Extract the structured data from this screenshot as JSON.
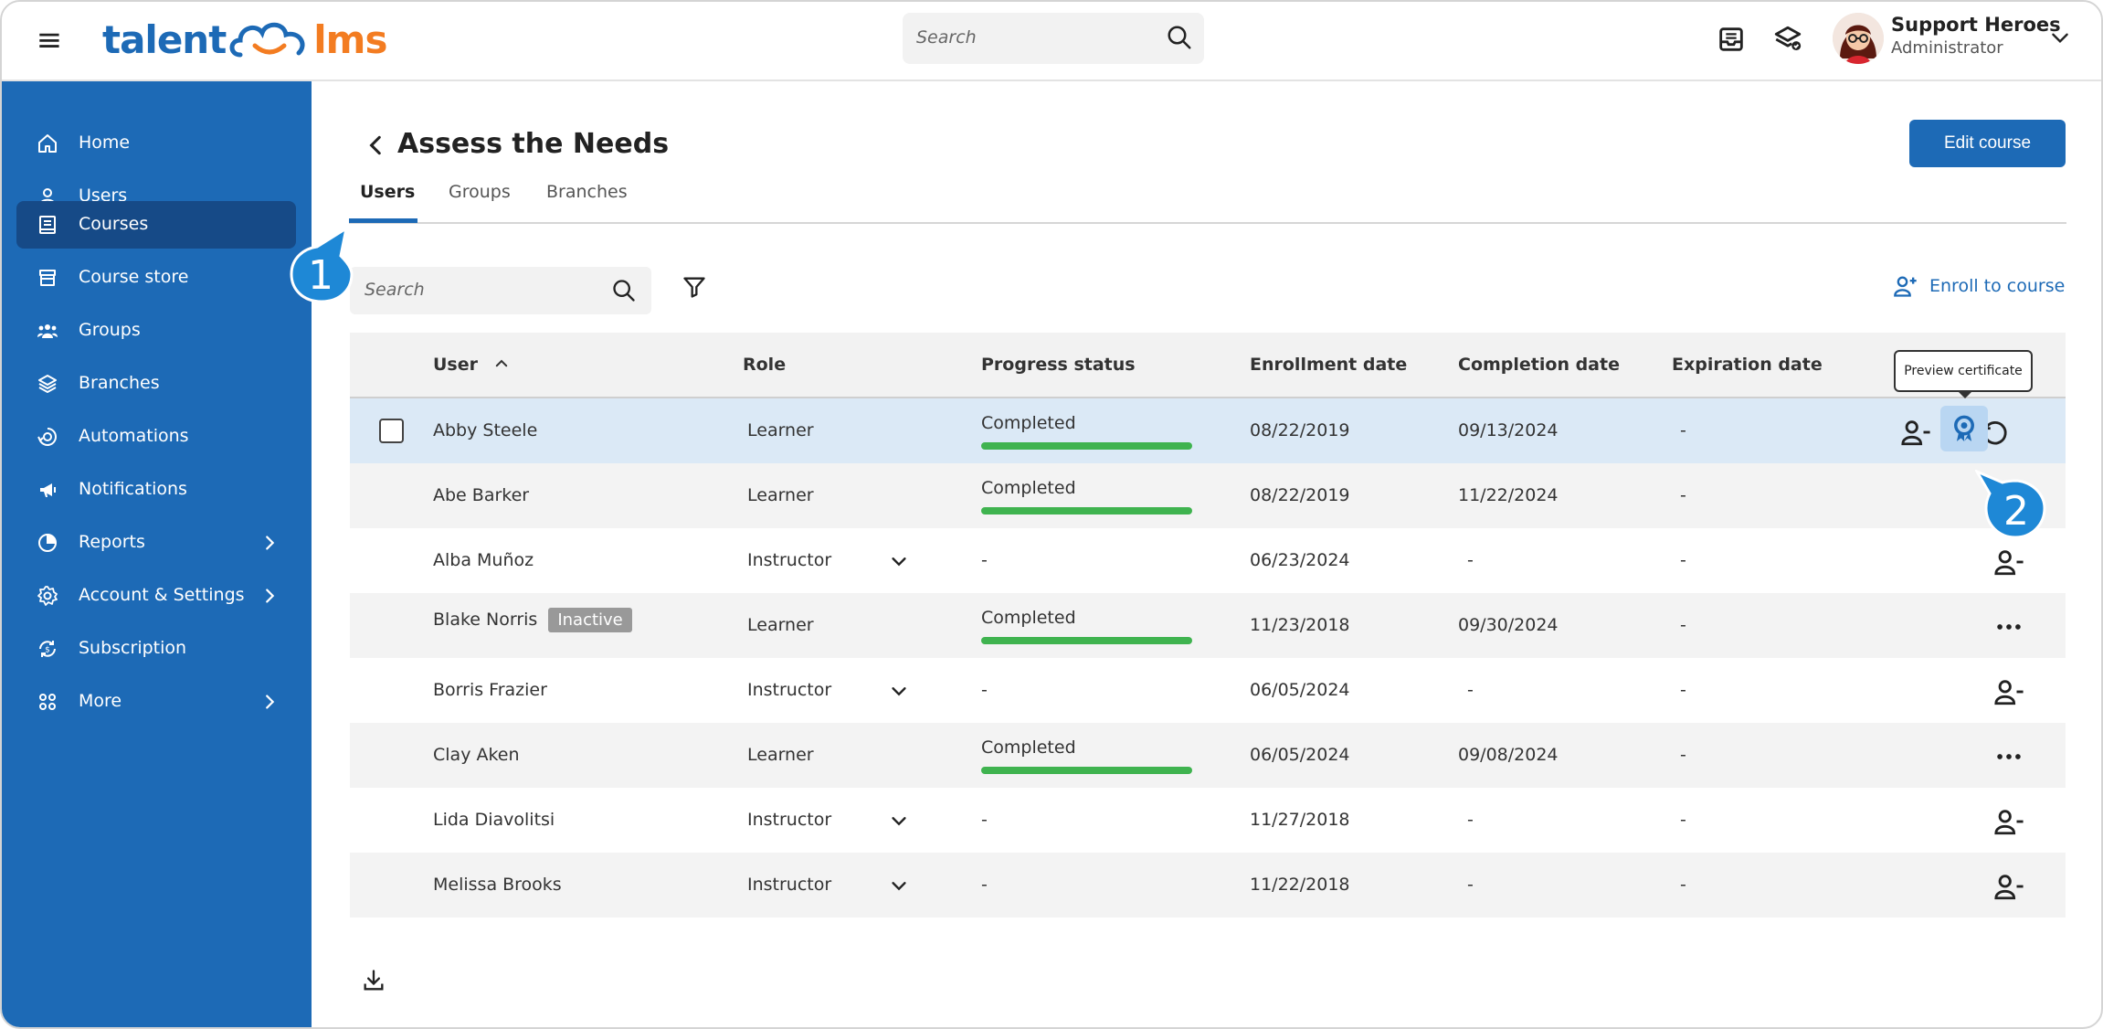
{
  "app": {
    "logo_part1": "talent",
    "logo_part2": "lms",
    "search_placeholder": "Search",
    "user_name": "Support Heroes",
    "user_role": "Administrator"
  },
  "sidebar": {
    "items": [
      {
        "label": "Home",
        "icon": "home-icon"
      },
      {
        "label": "Users",
        "icon": "user-icon"
      },
      {
        "label": "Courses",
        "icon": "book-icon",
        "active": true
      },
      {
        "label": "Course store",
        "icon": "store-icon"
      },
      {
        "label": "Groups",
        "icon": "groups-icon"
      },
      {
        "label": "Branches",
        "icon": "layers-icon"
      },
      {
        "label": "Automations",
        "icon": "automation-icon"
      },
      {
        "label": "Notifications",
        "icon": "megaphone-icon"
      },
      {
        "label": "Reports",
        "icon": "pie-chart-icon",
        "has_children": true
      },
      {
        "label": "Account & Settings",
        "icon": "gear-icon",
        "has_children": true
      },
      {
        "label": "Subscription",
        "icon": "subscription-icon"
      },
      {
        "label": "More",
        "icon": "grid-icon",
        "has_children": true
      }
    ]
  },
  "page": {
    "title": "Assess the Needs",
    "edit_button": "Edit course",
    "tabs": [
      "Users",
      "Groups",
      "Branches"
    ],
    "search_placeholder": "Search",
    "enroll_label": "Enroll to course",
    "tooltip": "Preview certificate",
    "callout_1": "1",
    "callout_2": "2"
  },
  "table": {
    "headers": {
      "user": "User",
      "role": "Role",
      "progress": "Progress status",
      "enrollment": "Enrollment date",
      "completion": "Completion date",
      "expiration": "Expiration date"
    },
    "rows": [
      {
        "user": "Abby Steele",
        "role": "Learner",
        "progress": "Completed",
        "progress_pct": 100,
        "enrollment": "08/22/2019",
        "completion": "09/13/2024",
        "expiration": "-"
      },
      {
        "user": "Abe Barker",
        "role": "Learner",
        "progress": "Completed",
        "progress_pct": 100,
        "enrollment": "08/22/2019",
        "completion": "11/22/2024",
        "expiration": "-"
      },
      {
        "user": "Alba Muñoz",
        "role": "Instructor",
        "progress": "-",
        "enrollment": "06/23/2024",
        "completion": "-",
        "expiration": "-"
      },
      {
        "user": "Blake Norris",
        "badge": "Inactive",
        "role": "Learner",
        "progress": "Completed",
        "progress_pct": 100,
        "enrollment": "11/23/2018",
        "completion": "09/30/2024",
        "expiration": "-"
      },
      {
        "user": "Borris Frazier",
        "role": "Instructor",
        "progress": "-",
        "enrollment": "06/05/2024",
        "completion": "-",
        "expiration": "-"
      },
      {
        "user": "Clay Aken",
        "role": "Learner",
        "progress": "Completed",
        "progress_pct": 100,
        "enrollment": "06/05/2024",
        "completion": "09/08/2024",
        "expiration": "-"
      },
      {
        "user": "Lida Diavolitsi",
        "role": "Instructor",
        "progress": "-",
        "enrollment": "11/27/2018",
        "completion": "-",
        "expiration": "-"
      },
      {
        "user": "Melissa Brooks",
        "role": "Instructor",
        "progress": "-",
        "enrollment": "11/22/2018",
        "completion": "-",
        "expiration": "-"
      }
    ]
  },
  "colors": {
    "brand_blue": "#1d6ab6",
    "brand_orange": "#f37c21",
    "sidebar_active": "#164a87",
    "progress_green": "#3fb34f",
    "callout_blue": "#1e88d6"
  }
}
